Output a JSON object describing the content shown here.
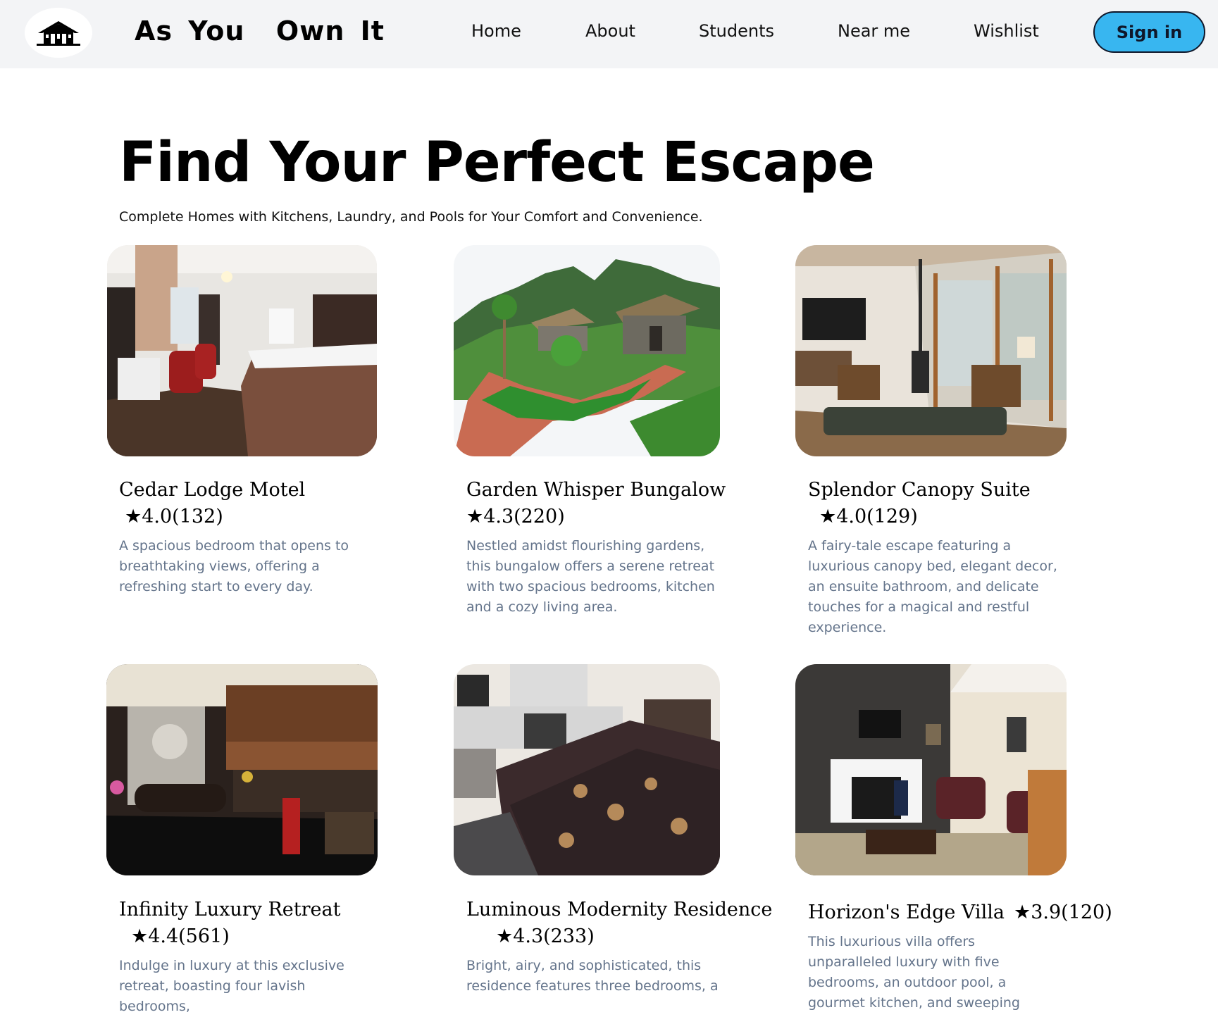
{
  "header": {
    "logo_icon": "house-logo-icon",
    "brand": "As You  Own It",
    "nav": [
      "Home",
      "About",
      "Students",
      "Near me",
      "Wishlist"
    ],
    "sign_in": "Sign in",
    "colors": {
      "background": "#f3f4f6",
      "sign_in_button": "#38b6f0"
    }
  },
  "hero": {
    "title": "Find Your Perfect Escape",
    "subtitle": "Complete Homes with Kitchens, Laundry, and Pools for Your Comfort and Convenience."
  },
  "listings": [
    {
      "name": "Cedar Lodge Motel",
      "rating": "★4.0(132)",
      "description": "A spacious bedroom that opens to breathtaking views, offering a refreshing start to every day.",
      "image": "motel-bedroom-photo"
    },
    {
      "name": "Garden Whisper Bungalow",
      "rating": "★4.3(220)",
      "description": "Nestled amidst flourishing gardens, this bungalow offers a serene retreat with two spacious bedrooms, kitchen and a cozy living area.",
      "image": "garden-bungalow-photo"
    },
    {
      "name": "Splendor Canopy Suite",
      "rating": "★4.0(129)",
      "description": "A fairy-tale escape featuring a luxurious canopy bed, elegant decor, an ensuite bathroom, and delicate touches for a magical and restful experience.",
      "image": "sunroom-photo"
    },
    {
      "name": "Infinity Luxury Retreat",
      "rating": "★4.4(561)",
      "description": "Indulge in luxury at this exclusive retreat, boasting four lavish bedrooms,",
      "image": "hotel-lobby-photo"
    },
    {
      "name": "Luminous Modernity Residence",
      "rating": "★4.3(233)",
      "description": "Bright, airy, and sophisticated, this residence features three bedrooms, a",
      "image": "modern-bedroom-photo"
    },
    {
      "name": "Horizon's Edge Villa",
      "rating": "★3.9(120)",
      "description": "This luxurious villa offers unparalleled luxury with five bedrooms, an outdoor pool, a gourmet kitchen, and sweeping",
      "image": "villa-living-room-photo"
    }
  ]
}
